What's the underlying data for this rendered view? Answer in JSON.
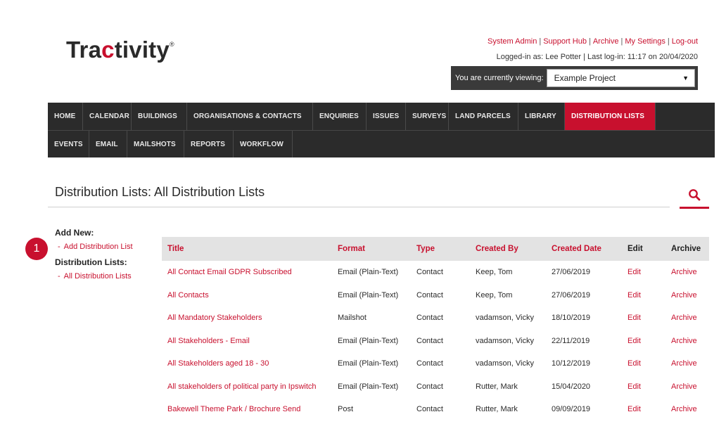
{
  "brand": {
    "logo_prefix": "Tra",
    "logo_accent": "c",
    "logo_suffix": "tivity",
    "logo_mark": "®",
    "accent_color": "#c8102e"
  },
  "header": {
    "links": [
      "System Admin",
      "Support Hub",
      "Archive",
      "My Settings",
      "Log-out"
    ],
    "separator": "|",
    "login_info": "Logged-in as: Lee Potter | Last log-in: 11:17 on 20/04/2020",
    "viewing_label": "You are currently viewing:",
    "viewing_value": "Example Project",
    "viewing_arrow": "▼"
  },
  "nav": {
    "row1": [
      "HOME",
      "CALENDAR",
      "BUILDINGS",
      "ORGANISATIONS & CONTACTS",
      "ENQUIRIES",
      "ISSUES",
      "SURVEYS",
      "LAND PARCELS",
      "LIBRARY",
      "DISTRIBUTION LISTS"
    ],
    "row2": [
      "EVENTS",
      "EMAIL",
      "MAILSHOTS",
      "REPORTS",
      "WORKFLOW"
    ],
    "active": "DISTRIBUTION LISTS"
  },
  "page": {
    "title": "Distribution Lists: All Distribution Lists",
    "search_icon": "search-icon"
  },
  "sidebar": {
    "add_new_heading": "Add New:",
    "add_link": "Add Distribution List",
    "lists_heading": "Distribution Lists:",
    "all_link": "All Distribution Lists",
    "dash": "-"
  },
  "callout": {
    "number": "1"
  },
  "table": {
    "headers": [
      "Title",
      "Format",
      "Type",
      "Created By",
      "Created Date",
      "Edit",
      "Archive"
    ],
    "rows": [
      [
        "All Contact Email GDPR Subscribed",
        "Email (Plain-Text)",
        "Contact",
        "Keep, Tom",
        "27/06/2019",
        "Edit",
        "Archive"
      ],
      [
        "All Contacts",
        "Email (Plain-Text)",
        "Contact",
        "Keep, Tom",
        "27/06/2019",
        "Edit",
        "Archive"
      ],
      [
        "All Mandatory Stakeholders",
        "Mailshot",
        "Contact",
        "vadamson, Vicky",
        "18/10/2019",
        "Edit",
        "Archive"
      ],
      [
        "All Stakeholders - Email",
        "Email (Plain-Text)",
        "Contact",
        "vadamson, Vicky",
        "22/11/2019",
        "Edit",
        "Archive"
      ],
      [
        "All Stakeholders aged 18 - 30",
        "Email (Plain-Text)",
        "Contact",
        "vadamson, Vicky",
        "10/12/2019",
        "Edit",
        "Archive"
      ],
      [
        "All stakeholders of political party in Ipswitch",
        "Email (Plain-Text)",
        "Contact",
        "Rutter, Mark",
        "15/04/2020",
        "Edit",
        "Archive"
      ],
      [
        "Bakewell Theme Park / Brochure Send",
        "Post",
        "Contact",
        "Rutter, Mark",
        "09/09/2019",
        "Edit",
        "Archive"
      ]
    ]
  }
}
